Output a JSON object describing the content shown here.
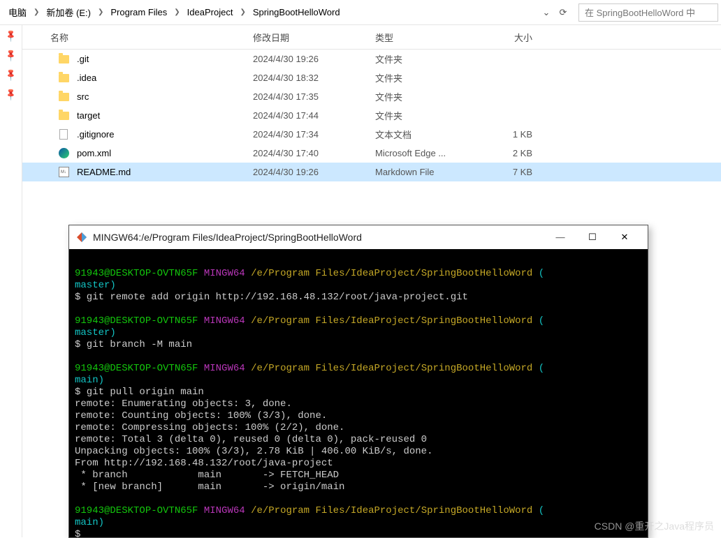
{
  "breadcrumb": {
    "items": [
      "电脑",
      "新加卷 (E:)",
      "Program Files",
      "IdeaProject",
      "SpringBootHelloWord"
    ]
  },
  "search": {
    "placeholder": "在 SpringBootHelloWord 中"
  },
  "columns": {
    "name": "名称",
    "date": "修改日期",
    "type": "类型",
    "size": "大小"
  },
  "files": [
    {
      "icon": "folder",
      "name": ".git",
      "date": "2024/4/30 19:26",
      "type": "文件夹",
      "size": ""
    },
    {
      "icon": "folder",
      "name": ".idea",
      "date": "2024/4/30 18:32",
      "type": "文件夹",
      "size": ""
    },
    {
      "icon": "folder",
      "name": "src",
      "date": "2024/4/30 17:35",
      "type": "文件夹",
      "size": ""
    },
    {
      "icon": "folder",
      "name": "target",
      "date": "2024/4/30 17:44",
      "type": "文件夹",
      "size": ""
    },
    {
      "icon": "txt",
      "name": ".gitignore",
      "date": "2024/4/30 17:34",
      "type": "文本文档",
      "size": "1 KB"
    },
    {
      "icon": "edge",
      "name": "pom.xml",
      "date": "2024/4/30 17:40",
      "type": "Microsoft Edge ...",
      "size": "2 KB"
    },
    {
      "icon": "md",
      "name": "README.md",
      "date": "2024/4/30 19:26",
      "type": "Markdown File",
      "size": "7 KB",
      "selected": true
    }
  ],
  "terminal": {
    "title": "MINGW64:/e/Program Files/IdeaProject/SpringBootHelloWord",
    "prompt_user": "91943@DESKTOP-OVTN65F",
    "prompt_env": "MINGW64",
    "prompt_path": "/e/Program Files/IdeaProject/SpringBootHelloWord",
    "branch_master": "master",
    "branch_main": "main",
    "cmd1": "$ git remote add origin http://192.168.48.132/root/java-project.git",
    "cmd2": "$ git branch -M main",
    "cmd3": "$ git pull origin main",
    "out1": "remote: Enumerating objects: 3, done.",
    "out2": "remote: Counting objects: 100% (3/3), done.",
    "out3": "remote: Compressing objects: 100% (2/2), done.",
    "out4": "remote: Total 3 (delta 0), reused 0 (delta 0), pack-reused 0",
    "out5": "Unpacking objects: 100% (3/3), 2.78 KiB | 406.00 KiB/s, done.",
    "out6": "From http://192.168.48.132/root/java-project",
    "out7": " * branch            main       -> FETCH_HEAD",
    "out8": " * [new branch]      main       -> origin/main",
    "prompt_last": "$"
  },
  "watermark": "CSDN @重开之Java程序员"
}
